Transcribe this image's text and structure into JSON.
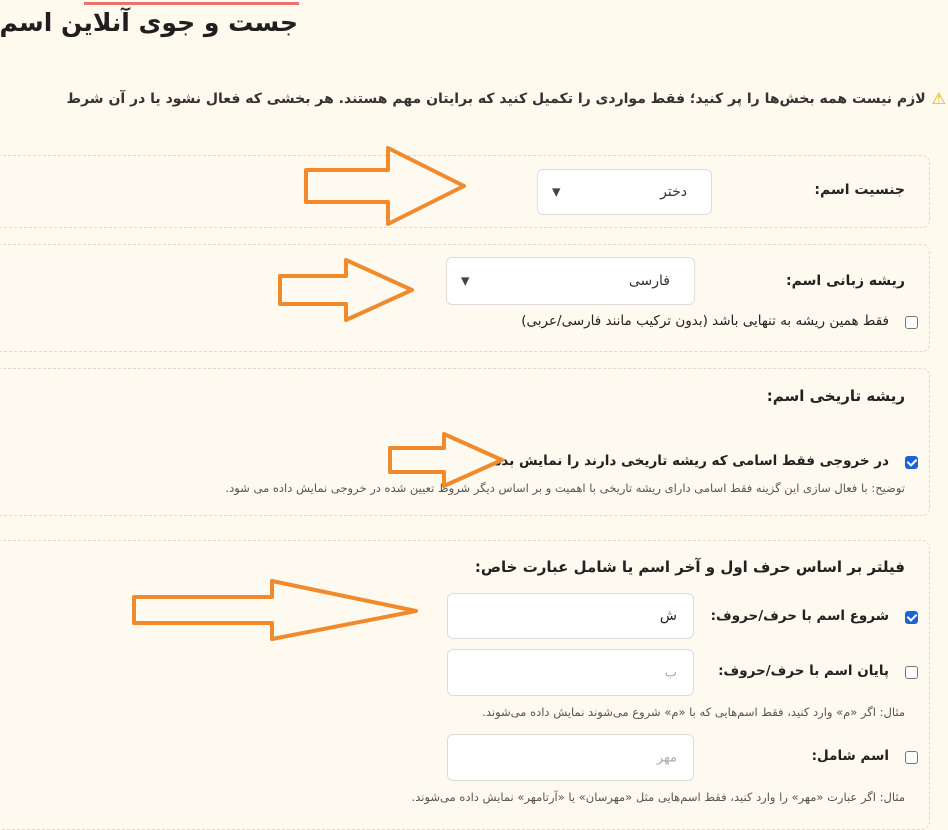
{
  "page": {
    "title": "جست و جوی آنلاین اسم",
    "notice": "لازم نیست همه بخش‌ها را پر کنید؛ فقط مواردی را تکمیل کنید که برایتان مهم هستند. هر بخشی که فعال نشود یا در آن شرط",
    "notice_icon": "warning-icon",
    "accent_color": "#f07070",
    "checkbox_color": "#1a62d6",
    "arrow_color": "#f08a2c"
  },
  "gender": {
    "label": "جنسیت اسم:",
    "selected": "دختر"
  },
  "language": {
    "label": "ریشه زبانی اسم:",
    "selected": "فارسی",
    "only_root_label": "فقط همین ریشه به تنهایی باشد (بدون ترکیب مانند فارسی/عربی)",
    "only_root_checked": false
  },
  "historical": {
    "heading": "ریشه تاریخی اسم:",
    "checkbox_label": "در خروجی فقط اسامی که ریشه تاریخی دارند را نمایش بده",
    "checked": true,
    "description": "توضیح: با فعال سازی این گزینه فقط اسامی دارای ریشه تاریخی با اهمیت و بر اساس دیگر شروط تعیین شده در خروجی نمایش داده می شود."
  },
  "filter": {
    "heading": "فیلتر بر اساس حرف اول و آخر اسم یا شامل عبارت خاص:",
    "start_label": "شروع اسم با حرف/حروف:",
    "start_checked": true,
    "start_value": "ش",
    "end_label": "پایان اسم با حرف/حروف:",
    "end_checked": false,
    "end_placeholder": "ب",
    "end_hint": "مثال: اگر «م» وارد کنید، فقط اسم‌هایی که با «م» شروع می‌شوند نمایش داده می‌شوند.",
    "contains_label": "اسم شامل:",
    "contains_checked": false,
    "contains_placeholder": "مهر",
    "contains_hint": "مثال: اگر عبارت «مهر» را وارد کنید، فقط اسم‌هایی مثل «مهرسان» یا «آرتامهر» نمایش داده می‌شوند."
  }
}
